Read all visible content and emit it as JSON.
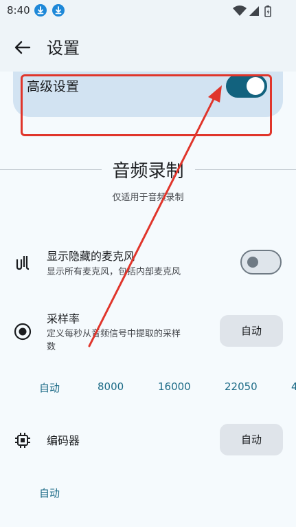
{
  "status_bar": {
    "time": "8:40",
    "icons": [
      "download-icon",
      "download-icon",
      "wifi-icon",
      "signal-icon",
      "battery-icon"
    ]
  },
  "app_bar": {
    "title": "设置",
    "back_icon": "arrow-back-icon"
  },
  "advanced": {
    "label": "高级设置",
    "enabled": true
  },
  "audio_section": {
    "title": "音频录制",
    "subtitle": "仅适用于音频录制"
  },
  "hidden_mics": {
    "title": "显示隐藏的麦克风",
    "desc": "显示所有麦克风，包括内部麦克风",
    "enabled": false
  },
  "sample_rate": {
    "title": "采样率",
    "desc_line1": "定义每秒从音频信号中提取的采样",
    "desc_line2": "数",
    "button": "自动",
    "options": [
      "自动",
      "8000",
      "16000",
      "22050",
      "4"
    ]
  },
  "encoder": {
    "title": "编码器",
    "button": "自动",
    "options": [
      "自动"
    ]
  },
  "colors": {
    "accent": "#12627e",
    "chip_text": "#1b6a86",
    "annotation": "#e0352b"
  }
}
